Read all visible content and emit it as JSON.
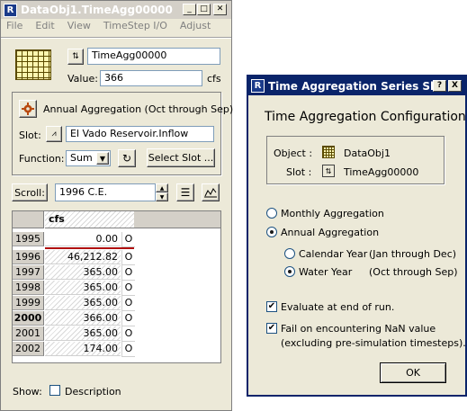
{
  "left_window": {
    "title": "DataObj1.TimeAgg00000",
    "menu": [
      "File",
      "Edit",
      "View",
      "TimeStep I/O",
      "Adjust"
    ],
    "slot_name": "TimeAgg00000",
    "value_label": "Value:",
    "value": "366",
    "unit": "cfs",
    "method_label": "Annual Aggregation (Oct through Sep)",
    "slot_label": "Slot:",
    "slot_value": "El Vado Reservoir.Inflow",
    "function_label": "Function:",
    "function_value": "Sum",
    "select_slot_label": "Select Slot ...",
    "scroll_label": "Scroll:",
    "scroll_value": "1996 C.E.",
    "table_header": "cfs",
    "rows": [
      {
        "year": "1995",
        "value": "0.00",
        "flag": "O"
      },
      {
        "year": "1996",
        "value": "46,212.82",
        "flag": "O"
      },
      {
        "year": "1997",
        "value": "365.00",
        "flag": "O"
      },
      {
        "year": "1998",
        "value": "365.00",
        "flag": "O"
      },
      {
        "year": "1999",
        "value": "365.00",
        "flag": "O"
      },
      {
        "year": "2000",
        "value": "366.00",
        "flag": "O"
      },
      {
        "year": "2001",
        "value": "365.00",
        "flag": "O"
      },
      {
        "year": "2002",
        "value": "174.00",
        "flag": "O"
      }
    ],
    "show_label": "Show:",
    "description_label": "Description"
  },
  "dialog": {
    "title": "Time Aggregation Series Slot ...",
    "help_label": "?",
    "close_label": "X",
    "heading": "Time Aggregation Configuration",
    "object_label": "Object :",
    "object_value": "DataObj1",
    "slot_label": "Slot :",
    "slot_value": "TimeAgg00000",
    "monthly_label": "Monthly Aggregation",
    "annual_label": "Annual Aggregation",
    "calendar_label": "Calendar Year",
    "calendar_desc": "(Jan through Dec)",
    "water_label": "Water Year",
    "water_desc": "(Oct through Sep)",
    "evaluate_label": "Evaluate at end of run.",
    "fail_label_1": "Fail on encountering NaN value",
    "fail_label_2": "(excluding pre-simulation timesteps).",
    "ok_label": "OK"
  }
}
